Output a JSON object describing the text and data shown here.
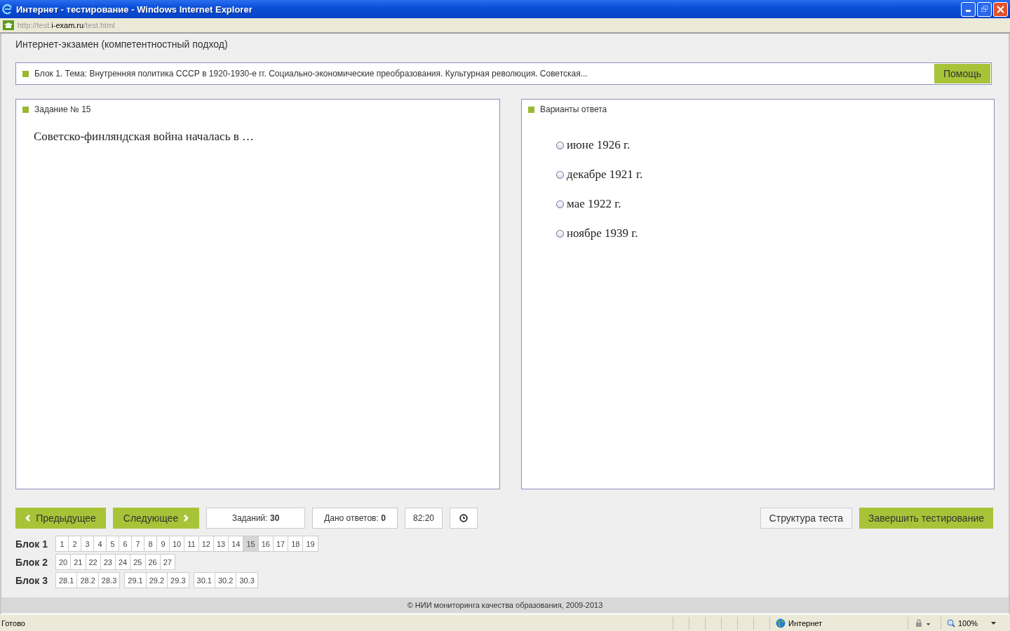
{
  "window": {
    "title": "Интернет - тестирование - Windows Internet Explorer"
  },
  "address": {
    "url_start": "http://test.",
    "url_domain": "i-exam.ru",
    "url_end": "/test.html"
  },
  "page_title": "Интернет-экзамен (компетентностный подход)",
  "topic": {
    "text": "Блок 1. Тема: Внутренняя политика СССР в 1920-1930-е гг. Социально-экономические преобразования. Культурная революция. Советская...",
    "help_button": "Помощь"
  },
  "task": {
    "heading": "Задание № 15",
    "question": "Советско-финляндская война началась в …"
  },
  "answers": {
    "heading": "Варианты ответа",
    "options": [
      {
        "label": "июне 1926 г.",
        "selected": false
      },
      {
        "label": "декабре 1921 г.",
        "selected": false
      },
      {
        "label": "мае 1922 г.",
        "selected": false
      },
      {
        "label": "ноябре 1939 г.",
        "selected": false
      }
    ]
  },
  "toolbar": {
    "prev": "Предыдущее",
    "next": "Следующее",
    "tasks_count": "Заданий: **30**",
    "answered": "Дано ответов: **0**",
    "timer": "82:20",
    "structure": "Структура теста",
    "finish": "Завершить тестирование"
  },
  "blocks": [
    {
      "label": "Блок 1",
      "groups": [
        [
          {
            "label": "1",
            "selected": false
          },
          {
            "label": "2",
            "selected": false
          },
          {
            "label": "3",
            "selected": false
          },
          {
            "label": "4",
            "selected": false
          },
          {
            "label": "5",
            "selected": false
          },
          {
            "label": "6",
            "selected": false
          },
          {
            "label": "7",
            "selected": false
          },
          {
            "label": "8",
            "selected": false
          },
          {
            "label": "9",
            "selected": false
          },
          {
            "label": "10",
            "selected": false
          },
          {
            "label": "11",
            "selected": false
          },
          {
            "label": "12",
            "selected": false
          },
          {
            "label": "13",
            "selected": false
          },
          {
            "label": "14",
            "selected": false
          },
          {
            "label": "15",
            "selected": true
          },
          {
            "label": "16",
            "selected": false
          },
          {
            "label": "17",
            "selected": false
          },
          {
            "label": "18",
            "selected": false
          },
          {
            "label": "19",
            "selected": false
          }
        ]
      ]
    },
    {
      "label": "Блок 2",
      "groups": [
        [
          {
            "label": "20",
            "selected": false
          },
          {
            "label": "21",
            "selected": false
          },
          {
            "label": "22",
            "selected": false
          },
          {
            "label": "23",
            "selected": false
          },
          {
            "label": "24",
            "selected": false
          },
          {
            "label": "25",
            "selected": false
          },
          {
            "label": "26",
            "selected": false
          },
          {
            "label": "27",
            "selected": false
          }
        ]
      ]
    },
    {
      "label": "Блок 3",
      "groups": [
        [
          {
            "label": "28.1",
            "selected": false
          },
          {
            "label": "28.2",
            "selected": false
          },
          {
            "label": "28.3",
            "selected": false
          }
        ],
        [
          {
            "label": "29.1",
            "selected": false
          },
          {
            "label": "29.2",
            "selected": false
          },
          {
            "label": "29.3",
            "selected": false
          }
        ],
        [
          {
            "label": "30.1",
            "selected": false
          },
          {
            "label": "30.2",
            "selected": false
          },
          {
            "label": "30.3",
            "selected": false
          }
        ]
      ]
    }
  ],
  "footer": "© НИИ мониторинга качества образования, 2009-2013",
  "status_bar": {
    "status": "Готово",
    "zone": "Интернет",
    "zoom": "100%"
  }
}
